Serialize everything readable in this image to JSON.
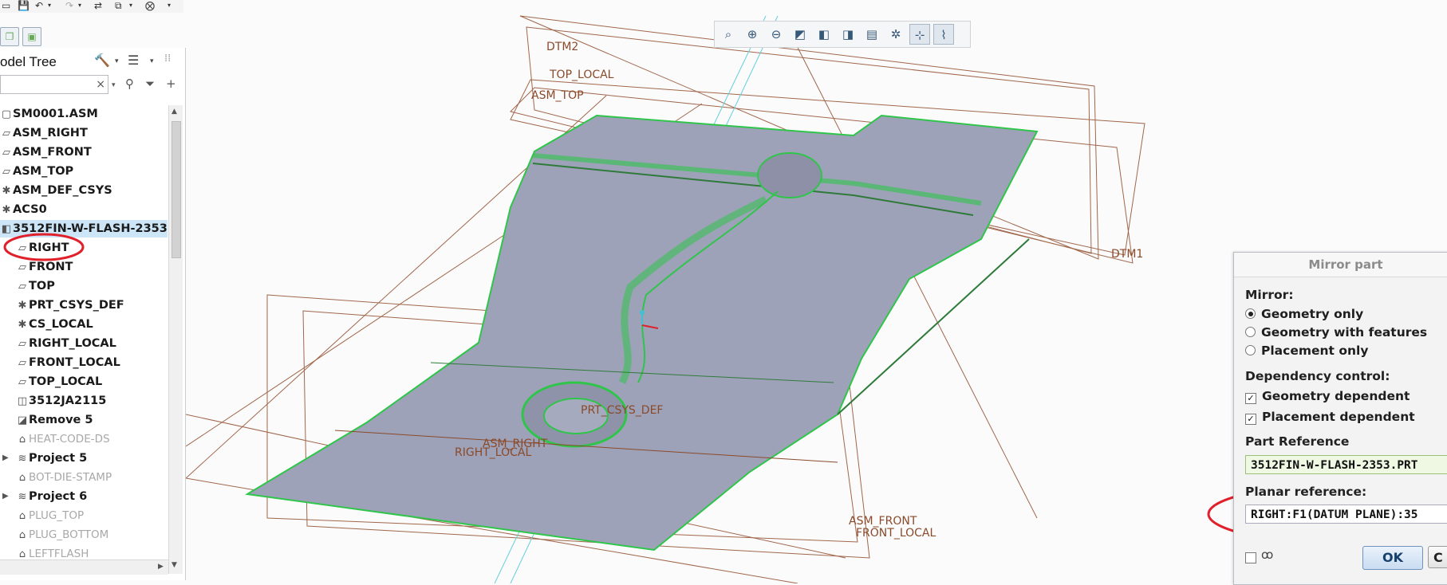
{
  "model_tree": {
    "title": "odel Tree",
    "search_value": "",
    "clear_glyph": "×",
    "items": [
      {
        "label": "SM0001.ASM",
        "icon": "assembly-icon",
        "indent": 0,
        "state": "normal"
      },
      {
        "label": "ASM_RIGHT",
        "icon": "datum-plane-icon",
        "indent": 0,
        "state": "normal"
      },
      {
        "label": "ASM_FRONT",
        "icon": "datum-plane-icon",
        "indent": 0,
        "state": "normal"
      },
      {
        "label": "ASM_TOP",
        "icon": "datum-plane-icon",
        "indent": 0,
        "state": "normal"
      },
      {
        "label": "ASM_DEF_CSYS",
        "icon": "csys-icon",
        "indent": 0,
        "state": "normal"
      },
      {
        "label": "ACS0",
        "icon": "csys-icon",
        "indent": 0,
        "state": "normal"
      },
      {
        "label": "3512FIN-W-FLASH-2353.",
        "icon": "part-icon",
        "indent": 0,
        "state": "selected"
      },
      {
        "label": "RIGHT",
        "icon": "datum-plane-icon",
        "indent": 1,
        "state": "normal"
      },
      {
        "label": "FRONT",
        "icon": "datum-plane-icon",
        "indent": 1,
        "state": "normal"
      },
      {
        "label": "TOP",
        "icon": "datum-plane-icon",
        "indent": 1,
        "state": "normal"
      },
      {
        "label": "PRT_CSYS_DEF",
        "icon": "csys-icon",
        "indent": 1,
        "state": "normal"
      },
      {
        "label": "CS_LOCAL",
        "icon": "csys-icon",
        "indent": 1,
        "state": "normal"
      },
      {
        "label": "RIGHT_LOCAL",
        "icon": "datum-plane-icon",
        "indent": 1,
        "state": "normal"
      },
      {
        "label": "FRONT_LOCAL",
        "icon": "datum-plane-icon",
        "indent": 1,
        "state": "normal"
      },
      {
        "label": "TOP_LOCAL",
        "icon": "datum-plane-icon",
        "indent": 1,
        "state": "normal"
      },
      {
        "label": "3512JA2115",
        "icon": "sub-part-icon",
        "indent": 1,
        "state": "normal"
      },
      {
        "label": "Remove 5",
        "icon": "remove-feature-icon",
        "indent": 1,
        "state": "normal"
      },
      {
        "label": "HEAT-CODE-DS",
        "icon": "suppressed-feature-icon",
        "indent": 1,
        "state": "dim"
      },
      {
        "label": "Project 5",
        "icon": "project-curve-icon",
        "indent": 1,
        "state": "expandable"
      },
      {
        "label": "BOT-DIE-STAMP",
        "icon": "suppressed-feature-icon",
        "indent": 1,
        "state": "dim"
      },
      {
        "label": "Project 6",
        "icon": "project-curve-icon",
        "indent": 1,
        "state": "expandable"
      },
      {
        "label": "PLUG_TOP",
        "icon": "suppressed-feature-icon",
        "indent": 1,
        "state": "dim"
      },
      {
        "label": "PLUG_BOTTOM",
        "icon": "suppressed-feature-icon",
        "indent": 1,
        "state": "dim"
      },
      {
        "label": "LEFTFLASH",
        "icon": "suppressed-feature-icon",
        "indent": 1,
        "state": "dim"
      }
    ]
  },
  "viewport": {
    "datum_labels": {
      "dtm2": "DTM2",
      "top_local": "TOP_LOCAL",
      "asm_top": "ASM_TOP",
      "dtm_right": "DTM1",
      "asm_front": "ASM_FRONT",
      "front_local": "FRONT_LOCAL",
      "right_local": "RIGHT_LOCAL",
      "asm_right": "ASM_RIGHT",
      "prt_csys": "PRT_CSYS_DEF"
    },
    "colors": {
      "part_fill": "#9ea2b8",
      "edge_green": "#2fc54a",
      "datum_brown": "#8a4a2a",
      "datum_cyan": "#5fd1e0",
      "highlight_red": "#e0202a"
    }
  },
  "dialog": {
    "title": "Mirror part",
    "mirror_label": "Mirror:",
    "mirror_options": [
      {
        "label": "Geometry only",
        "selected": true
      },
      {
        "label": "Geometry with features",
        "selected": false
      },
      {
        "label": "Placement only",
        "selected": false
      }
    ],
    "dependency_label": "Dependency control:",
    "dependency_options": [
      {
        "label": "Geometry dependent",
        "checked": true
      },
      {
        "label": "Placement dependent",
        "checked": true
      }
    ],
    "part_reference_label": "Part Reference",
    "part_reference_value": "3512FIN-W-FLASH-2353.PRT",
    "planar_reference_label": "Planar reference:",
    "planar_reference_value": "RIGHT:F1(DATUM PLANE):35",
    "ok_label": "OK",
    "cancel_label": "C",
    "check_glyph": "✓"
  },
  "icons": {
    "qat": [
      "save-icon",
      "undo-icon",
      "redo-icon",
      "regenerate-icon",
      "windows-icon",
      "close-window-icon",
      "customize-dropdown-icon"
    ],
    "graphics_toolbar": [
      "refit-icon",
      "zoom-in-icon",
      "zoom-out-icon",
      "repaint-icon",
      "display-style-icon",
      "saved-orientations-icon",
      "view-manager-icon",
      "datum-display-icon",
      "spin-center-icon",
      "annotation-display-icon"
    ]
  }
}
